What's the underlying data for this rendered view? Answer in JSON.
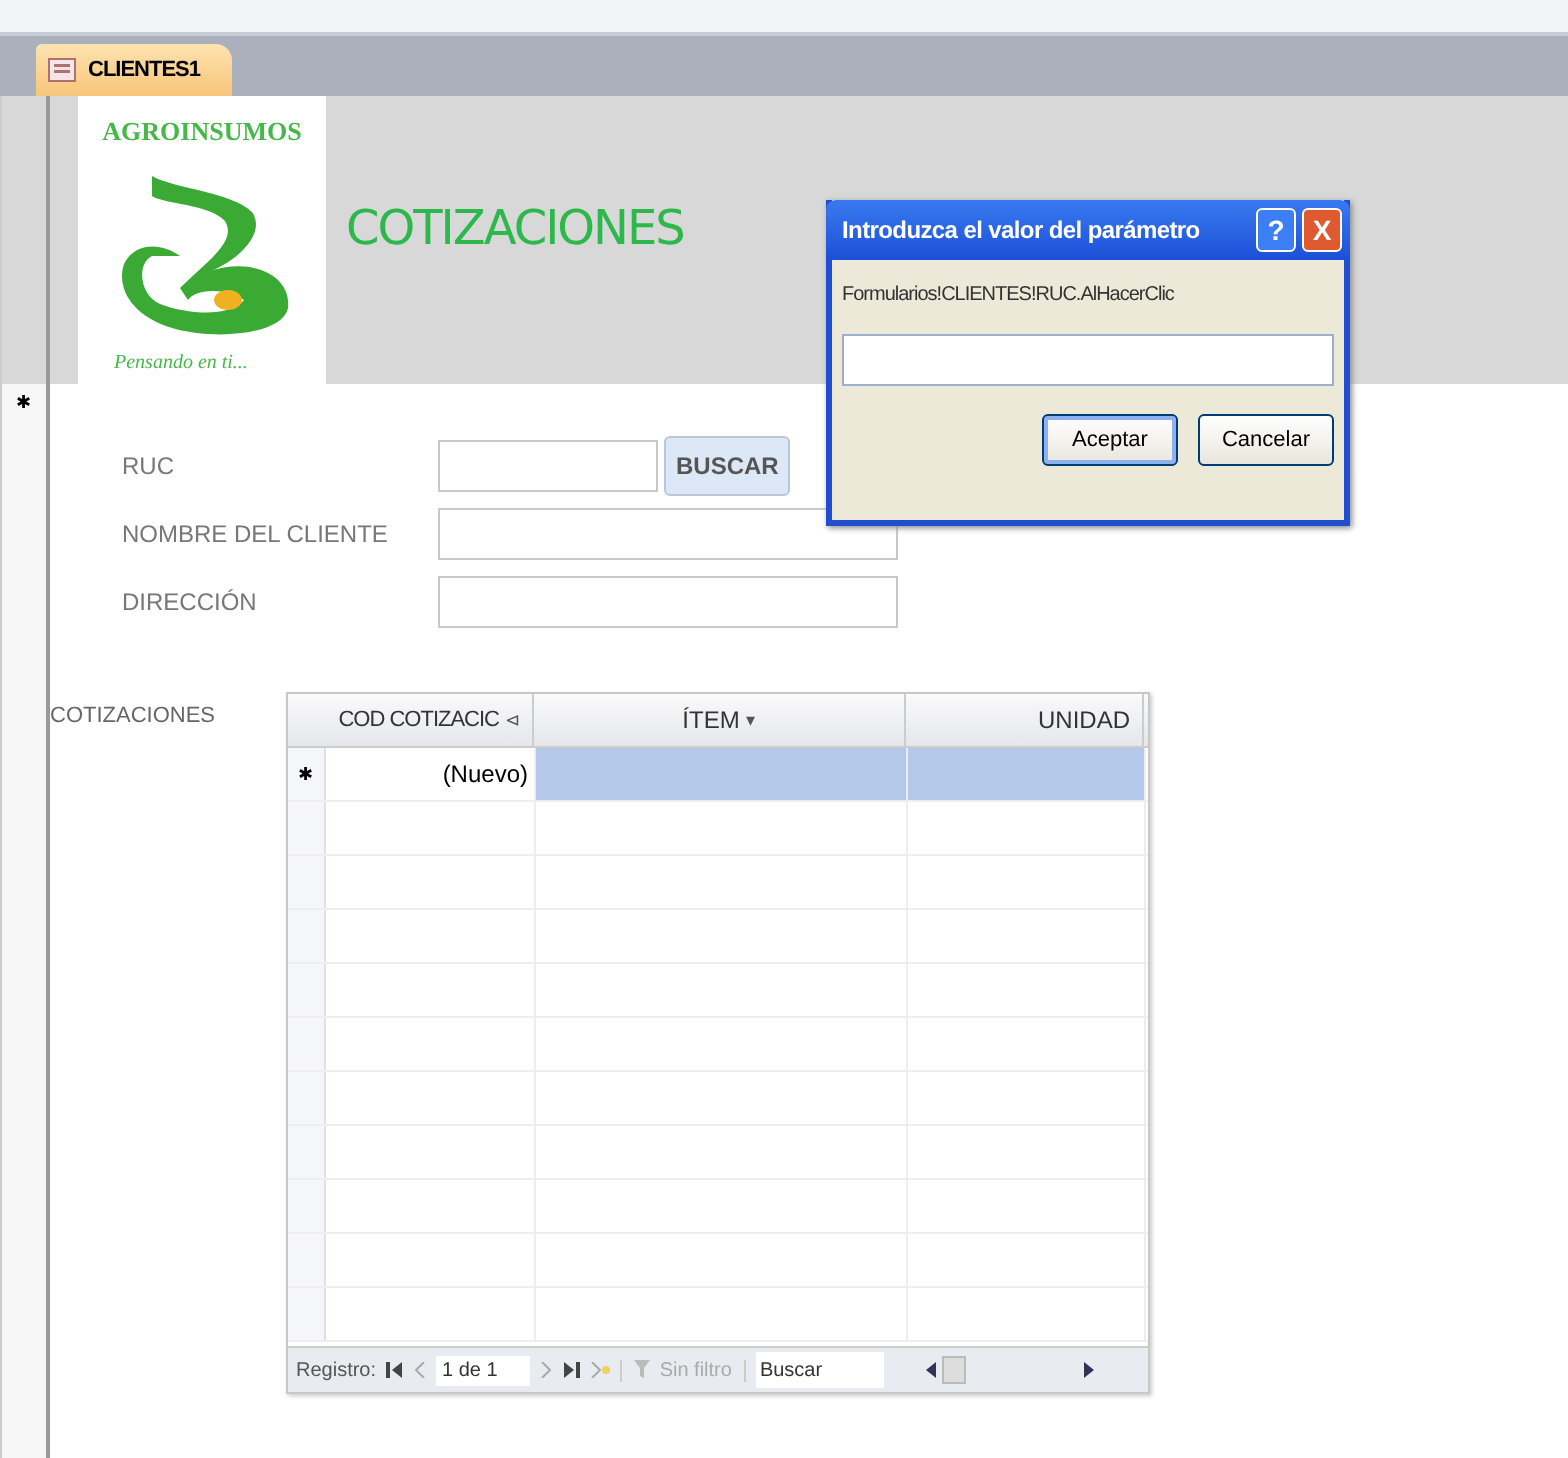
{
  "tabs": [
    {
      "label": "CLIENTES1",
      "selected": true
    }
  ],
  "header": {
    "logo_name": "AGROINSUMOS",
    "logo_slogan": "Pensando en ti...",
    "title": "COTIZACIONES"
  },
  "record_selector": "✱",
  "fields": [
    {
      "label": "RUC",
      "kind": "search"
    },
    {
      "label": "NOMBRE DEL CLIENTE",
      "kind": "text"
    },
    {
      "label": "DIRECCIÓN",
      "kind": "text"
    }
  ],
  "search_button": "BUSCAR",
  "subform": {
    "label": "COTIZACIONES",
    "columns": [
      {
        "label": "COD COTIZACIC",
        "sort": "⊲"
      },
      {
        "label": "ÍTEM",
        "sort": "▾"
      },
      {
        "label": "UNIDAD"
      }
    ],
    "new_row": {
      "selector": "✱",
      "cells": [
        "(Nuevo)",
        "",
        ""
      ],
      "selected": true
    },
    "navigation": {
      "label": "Registro:",
      "position": "1 de 1",
      "filter": "Sin filtro",
      "search_placeholder": "Buscar"
    }
  },
  "dialog": {
    "title": "Introduzca el valor del parámetro",
    "help": "?",
    "close": "X",
    "prompt": "Formularios!CLIENTES!RUC.AlHacerClic",
    "buttons": [
      "Aceptar",
      "Cancelar"
    ]
  }
}
